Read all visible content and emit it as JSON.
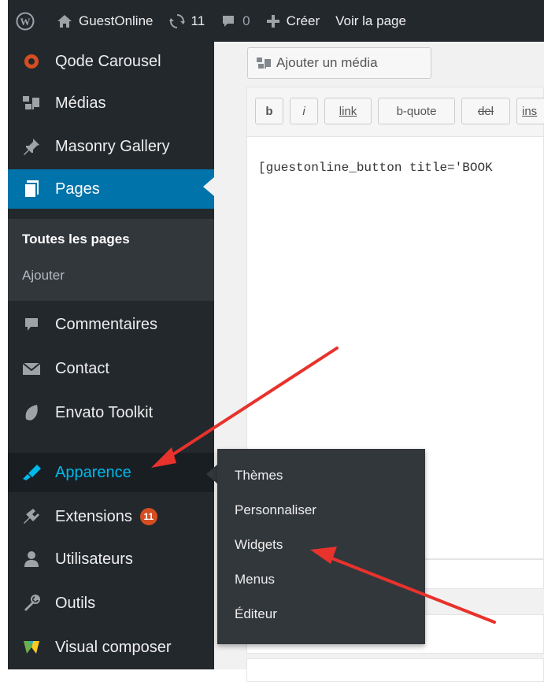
{
  "admin_bar": {
    "site_name": "GuestOnline",
    "updates_count": "11",
    "comments_count": "0",
    "new_label": "Créer",
    "view_label": "Voir la page"
  },
  "sidebar": {
    "items": [
      {
        "label": "Qode Carousel",
        "icon": "carousel-icon"
      },
      {
        "label": "Médias",
        "icon": "media-icon"
      },
      {
        "label": "Masonry Gallery",
        "icon": "pin-icon"
      },
      {
        "label": "Pages",
        "icon": "pages-icon"
      },
      {
        "label": "Commentaires",
        "icon": "comment-icon"
      },
      {
        "label": "Contact",
        "icon": "mail-icon"
      },
      {
        "label": "Envato Toolkit",
        "icon": "leaf-icon"
      },
      {
        "label": "Apparence",
        "icon": "brush-icon"
      },
      {
        "label": "Extensions",
        "icon": "plugin-icon",
        "badge": "11"
      },
      {
        "label": "Utilisateurs",
        "icon": "user-icon"
      },
      {
        "label": "Outils",
        "icon": "wrench-icon"
      },
      {
        "label": "Visual composer",
        "icon": "vc-icon"
      }
    ],
    "pages_submenu": [
      "Toutes les pages",
      "Ajouter"
    ]
  },
  "flyout": {
    "items": [
      "Thèmes",
      "Personnaliser",
      "Widgets",
      "Menus",
      "Éditeur"
    ]
  },
  "editor": {
    "add_media_label": "Ajouter un média",
    "toolbar": [
      "b",
      "i",
      "link",
      "b-quote",
      "del",
      "ins"
    ],
    "content": "[guestonline_button title='BOOK"
  },
  "colors": {
    "sidebar_bg": "#23282d",
    "current_bg": "#0073aa",
    "hover_text": "#00b9eb",
    "badge": "#d54e21",
    "annotation_arrow": "#e8322c"
  }
}
